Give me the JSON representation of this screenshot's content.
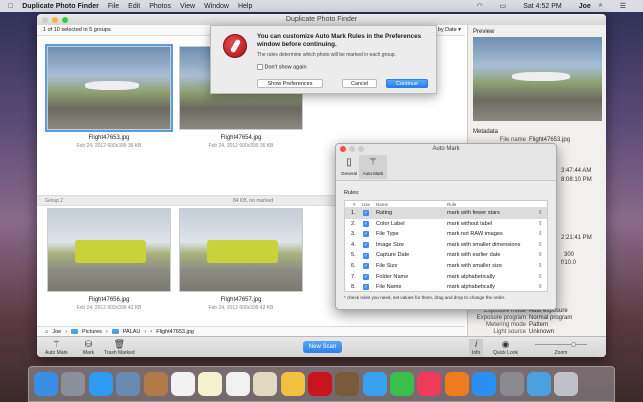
{
  "menubar": {
    "app": "Duplicate Photo Finder",
    "menus": [
      "File",
      "Edit",
      "Photos",
      "View",
      "Window",
      "Help"
    ],
    "clock": "Sat 4:52 PM",
    "user": "Joe"
  },
  "window": {
    "title": "Duplicate Photo Finder",
    "status": "1 of 10 selected in 5 groups",
    "sort": "Sort by Date ▾"
  },
  "photos": [
    {
      "name": "Flight47653.jpg",
      "meta": "Feb 24, 2012  600x399  36 KB"
    },
    {
      "name": "Flight47654.jpg",
      "meta": "Feb 24, 2012  600x399  36 KB"
    },
    {
      "name": "Flight47656.jpg",
      "meta": "Feb 24, 2012  600x399  42 KB"
    },
    {
      "name": "Flight47657.jpg",
      "meta": "Feb 24, 2012  600x399  42 KB"
    }
  ],
  "group2": {
    "label": "Group 2",
    "info": "84 KB, no marked"
  },
  "breadcrumb": [
    "Joe",
    "Pictures",
    "PALAU",
    "Flight47653.jpg"
  ],
  "toolbar": {
    "auto_mark": "Auto Mark",
    "mark": "Mark",
    "trash": "Trash Marked",
    "new_scan": "New Scan",
    "info": "Info",
    "quick_look": "Quick Look",
    "zoom": "Zoom"
  },
  "preview": {
    "title": "Preview",
    "metadata": "Metadata",
    "rows": [
      {
        "k": "File name",
        "v": "Flight47653.jpg"
      },
      {
        "k": "",
        "v": "3:47:44 AM"
      },
      {
        "k": "",
        "v": "8:08:10 PM"
      },
      {
        "k": "",
        "v": "2:21:41 PM"
      },
      {
        "k": "",
        "v": "300"
      },
      {
        "k": "",
        "v": "f/10.0"
      },
      {
        "k": "Exposure mode",
        "v": "Auto exposure"
      },
      {
        "k": "Exposure program",
        "v": "Normal program"
      },
      {
        "k": "Metering mode",
        "v": "Pattern"
      },
      {
        "k": "Light source",
        "v": "Unknown"
      }
    ]
  },
  "sheet": {
    "title": "You can customize Auto Mark Rules in the Preferences window before continuing.",
    "subtitle": "The rules determine which photo will be marked in each group.",
    "dont_show": "Don't show again",
    "show_prefs": "Show Preferences",
    "cancel": "Cancel",
    "continue": "Continue"
  },
  "automark": {
    "title": "Auto Mark",
    "tab_general": "General",
    "tab_automark": "Auto Mark",
    "rules_label": "Rules:",
    "headers": {
      "num": "#",
      "use": "Use",
      "name": "Name",
      "rule": "Rule"
    },
    "rules": [
      {
        "n": "1.",
        "name": "Rating",
        "rule": "mark with fewer stars"
      },
      {
        "n": "2.",
        "name": "Color Label",
        "rule": "mark without label"
      },
      {
        "n": "3.",
        "name": "File Type",
        "rule": "mark not RAW images"
      },
      {
        "n": "4.",
        "name": "Image Size",
        "rule": "mark with smaller dimensions"
      },
      {
        "n": "5.",
        "name": "Capture Date",
        "rule": "mark with earlier date"
      },
      {
        "n": "6.",
        "name": "File Size",
        "rule": "mark with smaller size"
      },
      {
        "n": "7.",
        "name": "Folder Name",
        "rule": "mark alphabetically"
      },
      {
        "n": "8.",
        "name": "File Name",
        "rule": "mark alphabetically"
      }
    ],
    "footnote": "* check rules you need, set values for them, drag and drop to change the order."
  },
  "dock_colors": [
    "#3a8ee6",
    "#8a8f9a",
    "#2f9bf0",
    "#6a8ab0",
    "#b07a4a",
    "#f2f2f2",
    "#f5f0d0",
    "#f0f0f0",
    "#e0d8c0",
    "#f2c040",
    "#c8141c",
    "#7a5a3a",
    "#3aa0f0",
    "#3ac04a",
    "#f03a5a",
    "#f07a20",
    "#2a8ef0",
    "#8a8a90",
    "#4aa0e0",
    "#c0c0c8"
  ]
}
